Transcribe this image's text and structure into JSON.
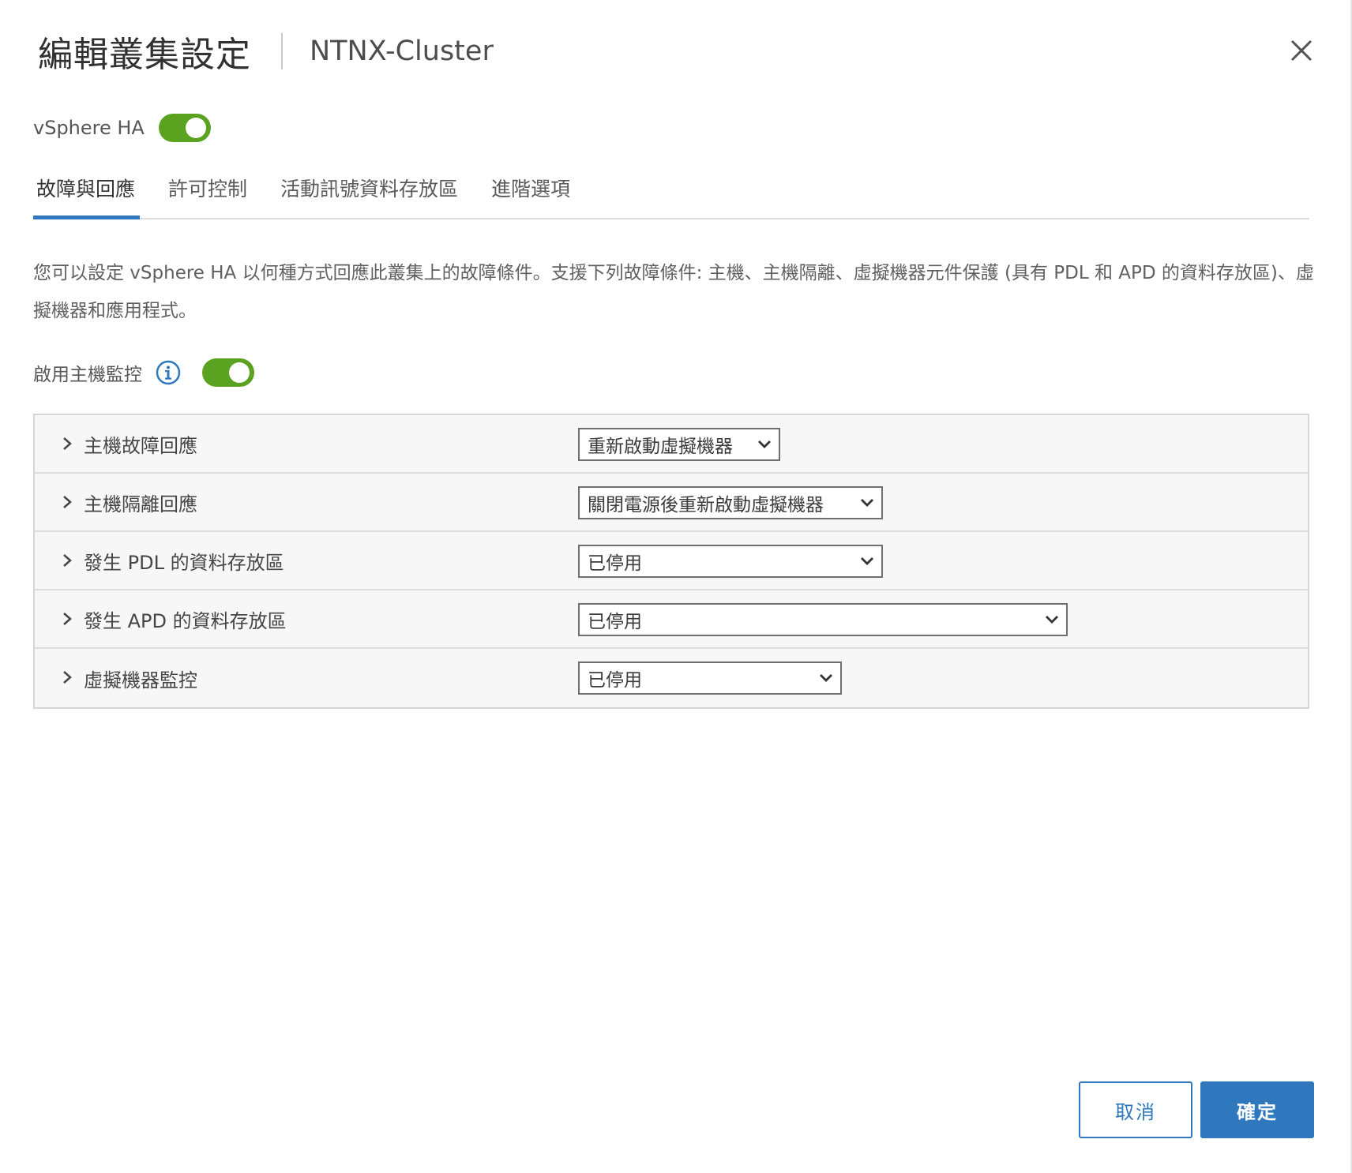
{
  "header": {
    "title": "編輯叢集設定",
    "subtitle": "NTNX-Cluster"
  },
  "ha": {
    "label": "vSphere HA",
    "enabled": true
  },
  "tabs": [
    {
      "label": "故障與回應",
      "active": true
    },
    {
      "label": "許可控制",
      "active": false
    },
    {
      "label": "活動訊號資料存放區",
      "active": false
    },
    {
      "label": "進階選項",
      "active": false
    }
  ],
  "description": "您可以設定 vSphere HA 以何種方式回應此叢集上的故障條件。支援下列故障條件: 主機、主機隔離、虛擬機器元件保護 (具有 PDL 和 APD 的資料存放區)、虛擬機器和應用程式。",
  "host_monitoring": {
    "label": "啟用主機監控",
    "enabled": true
  },
  "settings": [
    {
      "label": "主機故障回應",
      "value": "重新啟動虛擬機器"
    },
    {
      "label": "主機隔離回應",
      "value": "關閉電源後重新啟動虛擬機器"
    },
    {
      "label": "發生 PDL 的資料存放區",
      "value": "已停用"
    },
    {
      "label": "發生 APD 的資料存放區",
      "value": "已停用"
    },
    {
      "label": "虛擬機器監控",
      "value": "已停用"
    }
  ],
  "footer": {
    "cancel_label": "取消",
    "ok_label": "確定"
  },
  "colors": {
    "accent": "#2f78bd",
    "toggle_on": "#5aa220"
  }
}
